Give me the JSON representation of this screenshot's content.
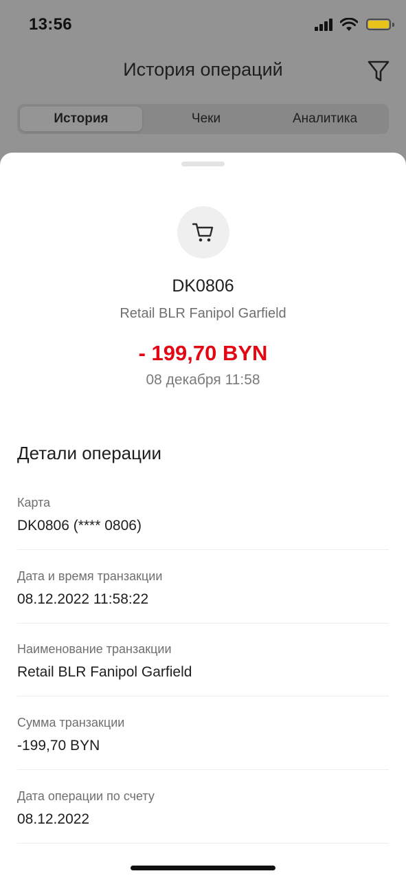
{
  "status_bar": {
    "time": "13:56"
  },
  "header": {
    "title": "История операций"
  },
  "tabs": [
    {
      "label": "История",
      "active": true
    },
    {
      "label": "Чеки",
      "active": false
    },
    {
      "label": "Аналитика",
      "active": false
    }
  ],
  "operation": {
    "icon": "cart-icon",
    "card_name": "DK0806",
    "merchant": "Retail BLR Fanipol Garfield",
    "amount": "- 199,70 BYN",
    "amount_color": "#e30613",
    "date": "08 декабря 11:58"
  },
  "details": {
    "title": "Детали операции",
    "rows": [
      {
        "label": "Карта",
        "value": "DK0806 (**** 0806)"
      },
      {
        "label": "Дата и время транзакции",
        "value": "08.12.2022 11:58:22"
      },
      {
        "label": "Наименование транзакции",
        "value": "Retail BLR Fanipol Garfield"
      },
      {
        "label": "Сумма транзакции",
        "value": "-199,70 BYN"
      },
      {
        "label": "Дата операции по счету",
        "value": "08.12.2022"
      }
    ]
  }
}
